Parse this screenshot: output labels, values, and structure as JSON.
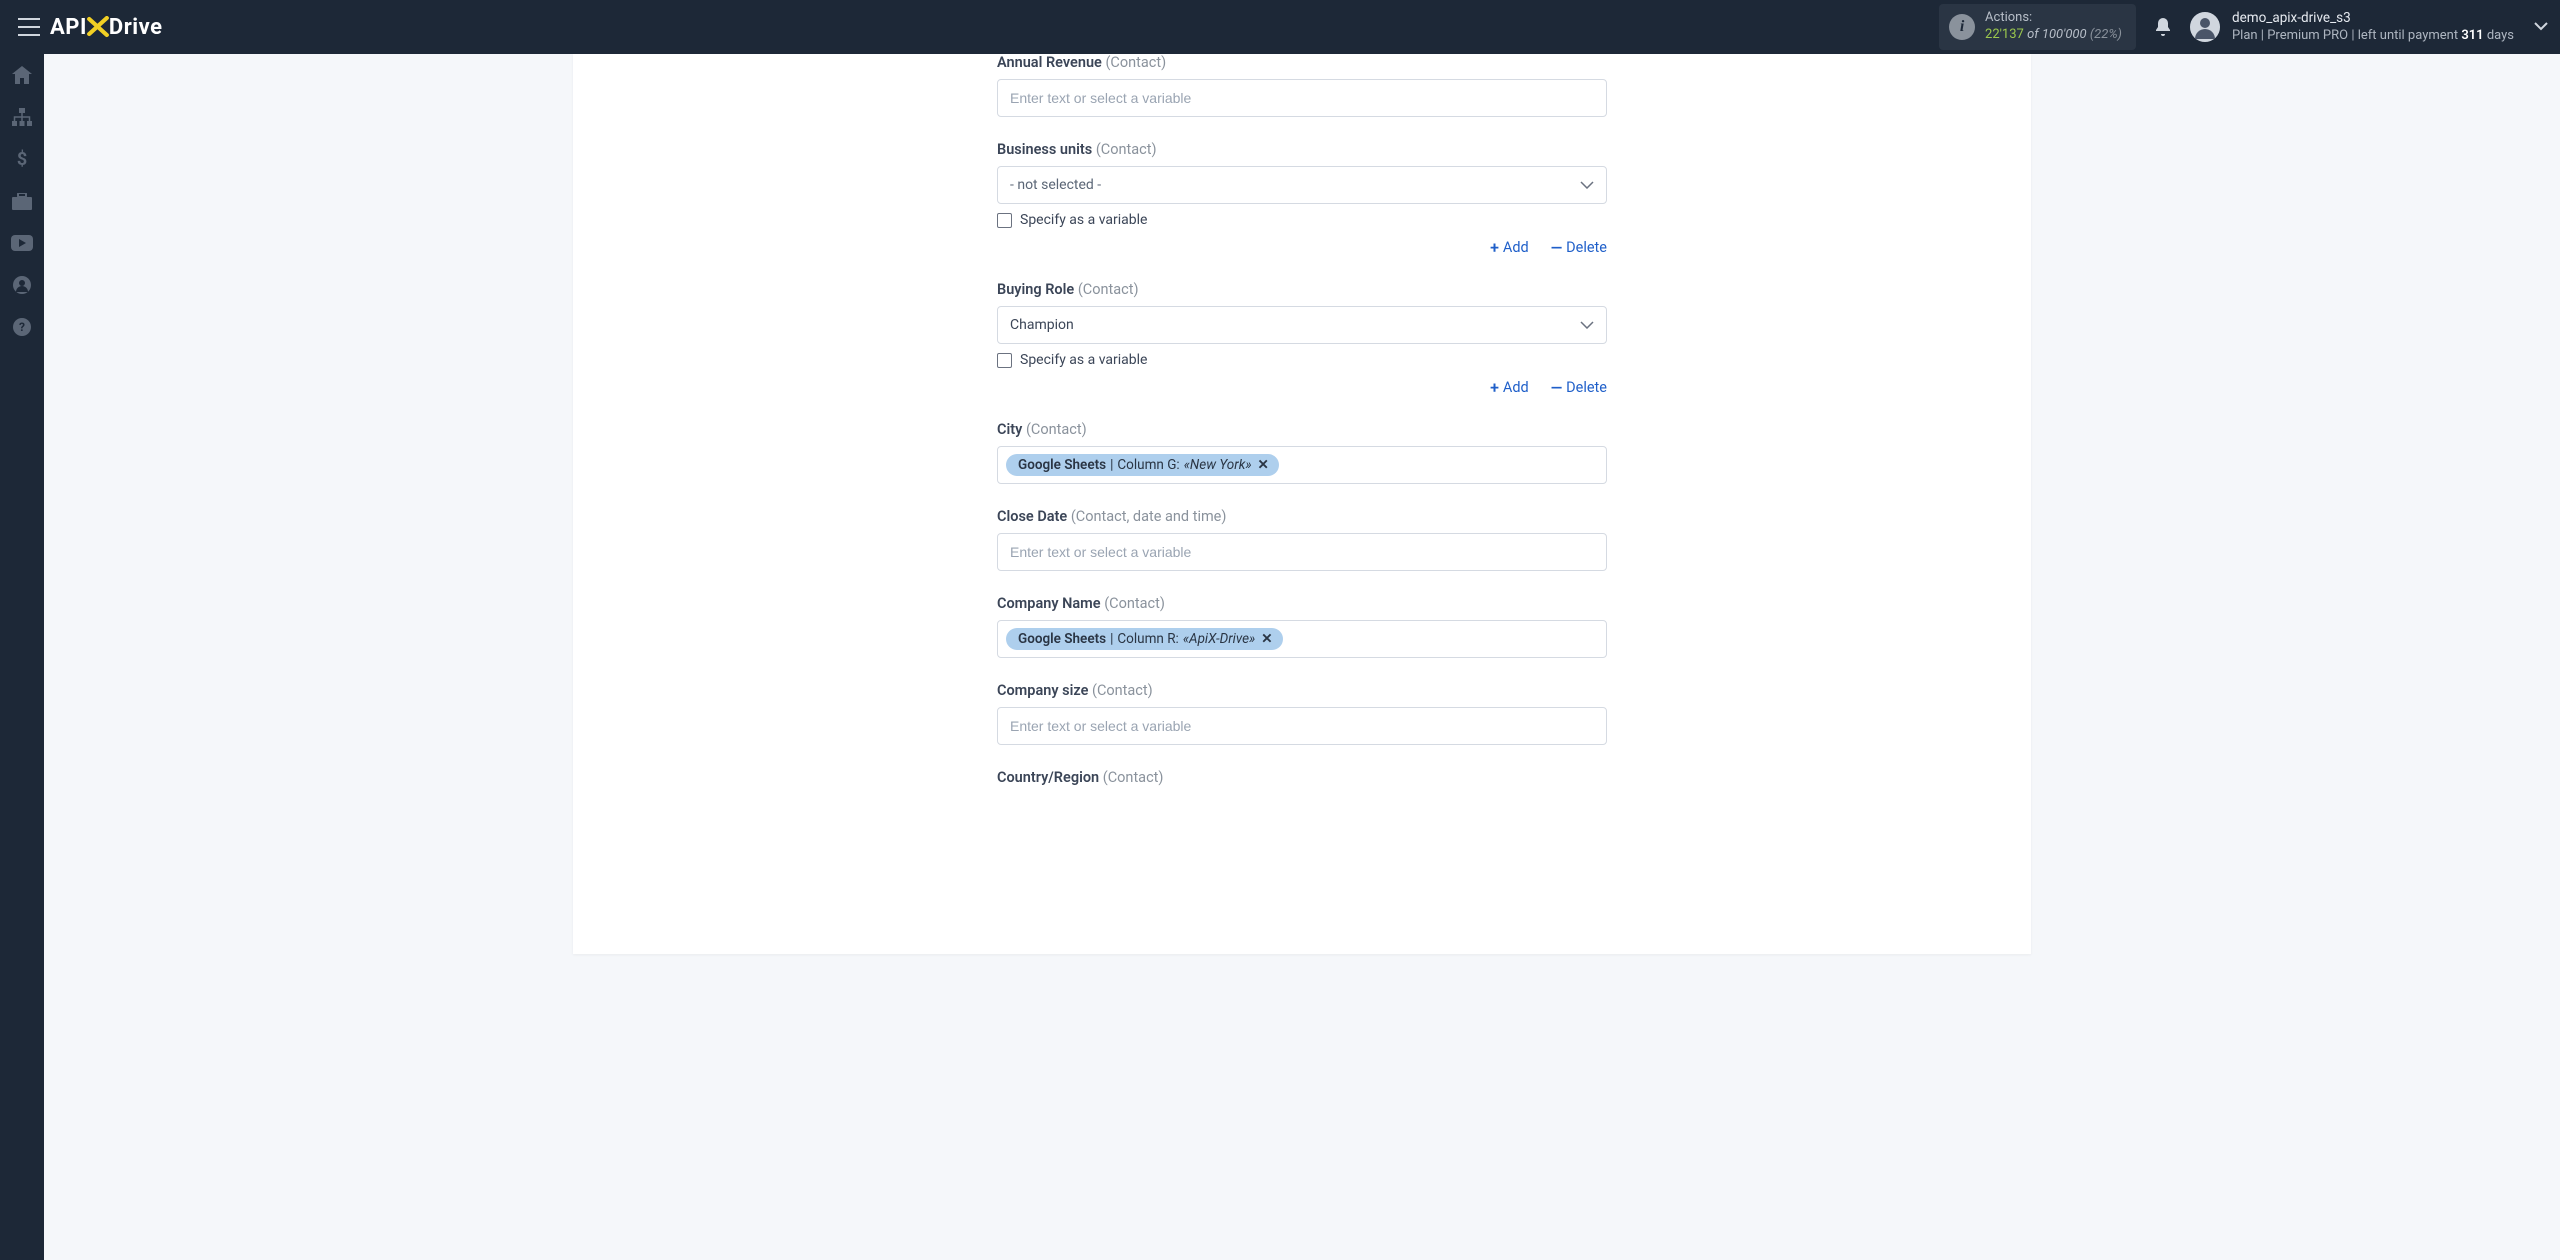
{
  "header": {
    "logo": {
      "pre": "API",
      "x": "X",
      "post": "Drive"
    },
    "actions": {
      "label": "Actions:",
      "count": "22'137",
      "of_word": "of",
      "total": "100'000",
      "pct": "(22%)"
    },
    "user": {
      "name": "demo_apix-drive_s3",
      "plan_prefix": "Plan |",
      "plan_name": "Premium PRO",
      "plan_mid": "| left until payment",
      "days": "311",
      "days_suffix": "days"
    }
  },
  "common": {
    "placeholder": "Enter text or select a variable",
    "specify_variable": "Specify as a variable",
    "add": "Add",
    "delete": "Delete",
    "not_selected": "- not selected -"
  },
  "fields": {
    "annual_revenue": {
      "label": "Annual Revenue",
      "sub": "(Contact)"
    },
    "business_units": {
      "label": "Business units",
      "sub": "(Contact)",
      "value": "- not selected -"
    },
    "buying_role": {
      "label": "Buying Role",
      "sub": "(Contact)",
      "value": "Champion"
    },
    "city": {
      "label": "City",
      "sub": "(Contact)",
      "chip_source": "Google Sheets",
      "chip_sep": " | ",
      "chip_col": "Column G: ",
      "chip_val": "«New York»"
    },
    "close_date": {
      "label": "Close Date",
      "sub": "(Contact, date and time)"
    },
    "company_name": {
      "label": "Company Name",
      "sub": "(Contact)",
      "chip_source": "Google Sheets",
      "chip_sep": " | ",
      "chip_col": "Column R: ",
      "chip_val": "«ApiX-Drive»"
    },
    "company_size": {
      "label": "Company size",
      "sub": "(Contact)"
    },
    "country_region": {
      "label": "Country/Region",
      "sub": "(Contact)"
    }
  }
}
